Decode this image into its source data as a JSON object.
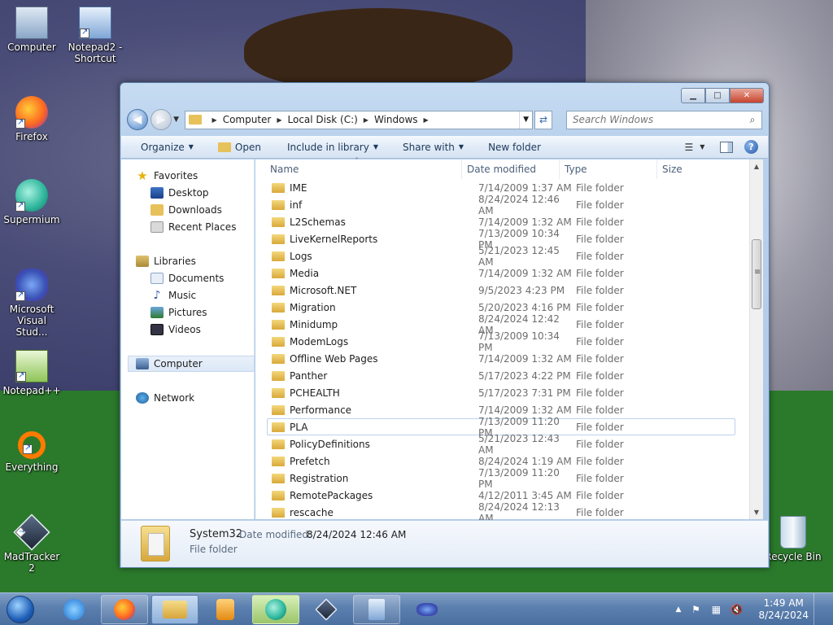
{
  "desktop": {
    "icons": [
      {
        "label": "Computer"
      },
      {
        "label": "Notepad2 - Shortcut"
      },
      {
        "label": "Firefox"
      },
      {
        "label": "Supermium"
      },
      {
        "label": "Microsoft Visual Stud..."
      },
      {
        "label": "Notepad++"
      },
      {
        "label": "Everything"
      },
      {
        "label": "MadTracker 2"
      },
      {
        "label": "Recycle Bin"
      }
    ]
  },
  "window": {
    "address": {
      "crumbs": [
        "Computer",
        "Local Disk (C:)",
        "Windows"
      ]
    },
    "search": {
      "placeholder": "Search Windows"
    },
    "toolbar": {
      "organize": "Organize",
      "open": "Open",
      "include_in_library": "Include in library",
      "share_with": "Share with",
      "new_folder": "New folder"
    },
    "nav": {
      "favorites": "Favorites",
      "desktop": "Desktop",
      "downloads": "Downloads",
      "recent_places": "Recent Places",
      "libraries": "Libraries",
      "documents": "Documents",
      "music": "Music",
      "pictures": "Pictures",
      "videos": "Videos",
      "computer": "Computer",
      "network": "Network"
    },
    "columns": {
      "name": "Name",
      "date": "Date modified",
      "type": "Type",
      "size": "Size"
    },
    "files": [
      {
        "name": "IME",
        "date": "7/14/2009 1:37 AM",
        "type": "File folder"
      },
      {
        "name": "inf",
        "date": "8/24/2024 12:46 AM",
        "type": "File folder"
      },
      {
        "name": "L2Schemas",
        "date": "7/14/2009 1:32 AM",
        "type": "File folder"
      },
      {
        "name": "LiveKernelReports",
        "date": "7/13/2009 10:34 PM",
        "type": "File folder"
      },
      {
        "name": "Logs",
        "date": "5/21/2023 12:45 AM",
        "type": "File folder"
      },
      {
        "name": "Media",
        "date": "7/14/2009 1:32 AM",
        "type": "File folder"
      },
      {
        "name": "Microsoft.NET",
        "date": "9/5/2023 4:23 PM",
        "type": "File folder"
      },
      {
        "name": "Migration",
        "date": "5/20/2023 4:16 PM",
        "type": "File folder"
      },
      {
        "name": "Minidump",
        "date": "8/24/2024 12:42 AM",
        "type": "File folder"
      },
      {
        "name": "ModemLogs",
        "date": "7/13/2009 10:34 PM",
        "type": "File folder"
      },
      {
        "name": "Offline Web Pages",
        "date": "7/14/2009 1:32 AM",
        "type": "File folder"
      },
      {
        "name": "Panther",
        "date": "5/17/2023 4:22 PM",
        "type": "File folder"
      },
      {
        "name": "PCHEALTH",
        "date": "5/17/2023 7:31 PM",
        "type": "File folder"
      },
      {
        "name": "Performance",
        "date": "7/14/2009 1:32 AM",
        "type": "File folder"
      },
      {
        "name": "PLA",
        "date": "7/13/2009 11:20 PM",
        "type": "File folder"
      },
      {
        "name": "PolicyDefinitions",
        "date": "5/21/2023 12:43 AM",
        "type": "File folder"
      },
      {
        "name": "Prefetch",
        "date": "8/24/2024 1:19 AM",
        "type": "File folder"
      },
      {
        "name": "Registration",
        "date": "7/13/2009 11:20 PM",
        "type": "File folder"
      },
      {
        "name": "RemotePackages",
        "date": "4/12/2011 3:45 AM",
        "type": "File folder"
      },
      {
        "name": "rescache",
        "date": "8/24/2024 12:13 AM",
        "type": "File folder"
      }
    ],
    "details": {
      "name": "System32",
      "date_label": "Date modified:",
      "date_value": "8/24/2024 12:46 AM",
      "type": "File folder"
    }
  },
  "taskbar": {
    "clock_time": "1:49 AM",
    "clock_date": "8/24/2024"
  }
}
